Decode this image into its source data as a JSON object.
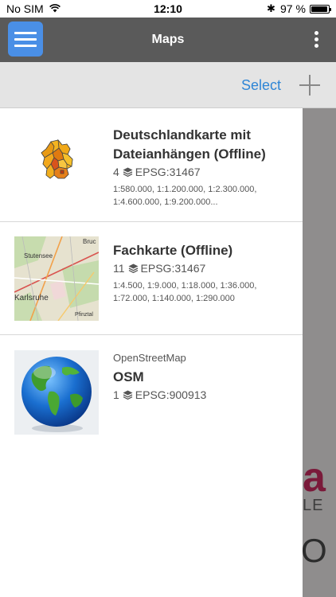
{
  "status_bar": {
    "carrier": "No SIM",
    "time": "12:10",
    "bluetooth_icon": "bluetooth-icon",
    "battery_percent": "97 %",
    "battery_level": 0.97
  },
  "nav_bar": {
    "title": "Maps",
    "menu_icon": "hamburger-icon",
    "more_icon": "more-vertical-icon",
    "menu_color": "#4a8fe6"
  },
  "toolbar": {
    "select_label": "Select",
    "add_icon": "plus-icon",
    "accent": "#2f86d6"
  },
  "maps": [
    {
      "title_line1": "Deutschlandkarte mit",
      "title_line2": "Dateianhängen (Offline)",
      "layer_count": "4",
      "epsg": "EPSG:31467",
      "scales_line1": "1:580.000, 1:1.200.000, 1:2.300.000,",
      "scales_line2": "1:4.600.000, 1:9.200.000..."
    },
    {
      "title": "Fachkarte (Offline)",
      "layer_count": "11",
      "epsg": "EPSG:31467",
      "scales_line1": "1:4.500, 1:9.000, 1:18.000, 1:36.000,",
      "scales_line2": "1:72.000, 1:140.000, 1:290.000",
      "thumb_labels": [
        "Bruc",
        "Stutensee",
        "Karlsruhe",
        "Pfinztal"
      ]
    },
    {
      "subtitle": "OpenStreetMap",
      "title": "OSM",
      "layer_count": "1",
      "epsg": "EPSG:900913"
    }
  ],
  "background": {
    "peek_letter": "a",
    "peek_text": "LE",
    "peek_char": "O"
  }
}
